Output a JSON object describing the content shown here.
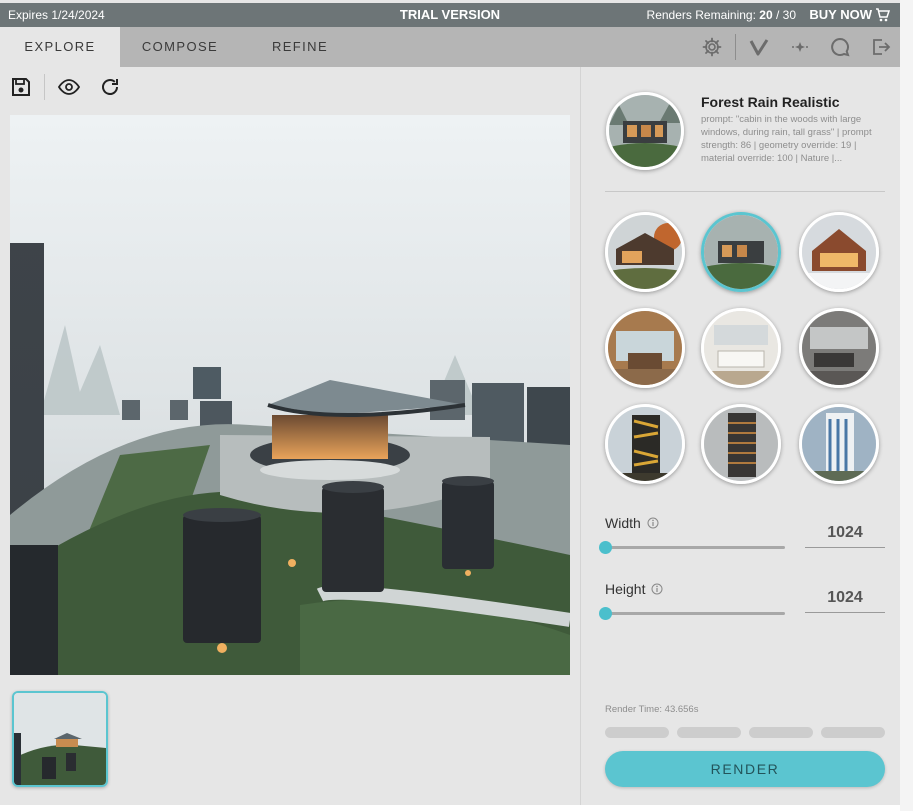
{
  "banner": {
    "expires": "Expires 1/24/2024",
    "trial_label": "TRIAL VERSION",
    "renders_label": "Renders Remaining:",
    "renders_used": "20",
    "renders_total": "/ 30",
    "buy_label": "BUY NOW",
    "buy_icon": "cart-icon"
  },
  "tabs": [
    {
      "label": "EXPLORE",
      "active": true
    },
    {
      "label": "COMPOSE",
      "active": false
    },
    {
      "label": "REFINE",
      "active": false
    }
  ],
  "tabbar_icons": [
    "gear-icon",
    "check-icon",
    "sparkle-icon",
    "chat-icon",
    "logout-icon"
  ],
  "toolbar_icons": [
    "save-icon",
    "eye-icon",
    "refresh-icon"
  ],
  "preset": {
    "title": "Forest Rain Realistic",
    "description": "prompt: \"cabin in the woods with large windows, during rain, tall grass\" | prompt strength: 86 | geometry override: 19 | material override: 100 | Nature |..."
  },
  "styles": [
    "modern-cabin-autumn",
    "forest-rain-realistic",
    "winter-house",
    "wood-interior",
    "white-kitchen-interior",
    "concrete-living-room",
    "gold-tower",
    "dark-highrise",
    "white-blue-highrise"
  ],
  "selected_style_index": 1,
  "width": {
    "label": "Width",
    "value": "1024"
  },
  "height": {
    "label": "Height",
    "value": "1024"
  },
  "render_time": "Render Time: 43.656s",
  "render_label": "RENDER",
  "colors": {
    "accent": "#5bc5d0",
    "banner": "#6d7577",
    "tabbar": "#b5b5b5",
    "panel": "#e6e6e6"
  }
}
